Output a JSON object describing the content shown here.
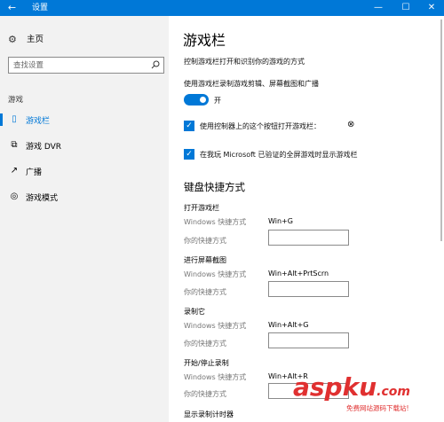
{
  "window": {
    "title": "设置",
    "back_glyph": "←",
    "min_glyph": "—",
    "max_glyph": "☐",
    "close_glyph": "✕"
  },
  "sidebar": {
    "home_label": "主页",
    "search_placeholder": "查找设置",
    "section_label": "游戏",
    "items": [
      {
        "label": "游戏栏",
        "icon": "game-bar-icon",
        "glyph": "▯",
        "active": true
      },
      {
        "label": "游戏 DVR",
        "icon": "dvr-icon",
        "glyph": "⧉",
        "active": false
      },
      {
        "label": "广播",
        "icon": "broadcast-icon",
        "glyph": "↗",
        "active": false
      },
      {
        "label": "游戏模式",
        "icon": "game-mode-icon",
        "glyph": "◎",
        "active": false
      }
    ]
  },
  "main": {
    "title": "游戏栏",
    "description": "控制游戏栏打开和识别你的游戏的方式",
    "record_label": "使用游戏栏录制游戏剪辑、屏幕截图和广播",
    "toggle_state": "开",
    "checkbox1_label": "使用控制器上的这个按钮打开游戏栏：",
    "xbox_glyph": "⊗",
    "checkbox2_label": "在我玩 Microsoft 已验证的全屏游戏时显示游戏栏",
    "shortcuts_title": "键盘快捷方式",
    "shortcuts": [
      {
        "name": "打开游戏栏",
        "windows_label": "Windows 快捷方式",
        "windows_value": "Win+G",
        "yours_label": "你的快捷方式",
        "yours_value": ""
      },
      {
        "name": "进行屏幕截图",
        "windows_label": "Windows 快捷方式",
        "windows_value": "Win+Alt+PrtScrn",
        "yours_label": "你的快捷方式",
        "yours_value": ""
      },
      {
        "name": "录制它",
        "windows_label": "Windows 快捷方式",
        "windows_value": "Win+Alt+G",
        "yours_label": "你的快捷方式",
        "yours_value": ""
      },
      {
        "name": "开始/停止录制",
        "windows_label": "Windows 快捷方式",
        "windows_value": "Win+Alt+R",
        "yours_label": "你的快捷方式",
        "yours_value": ""
      }
    ],
    "next_group": "显示录制计时器"
  },
  "watermark": {
    "logo": "aspku",
    "logo_suffix": ".com",
    "subtitle": "免费网站源码下载站!"
  },
  "colors": {
    "accent": "#0078d7",
    "watermark": "#e03030"
  }
}
